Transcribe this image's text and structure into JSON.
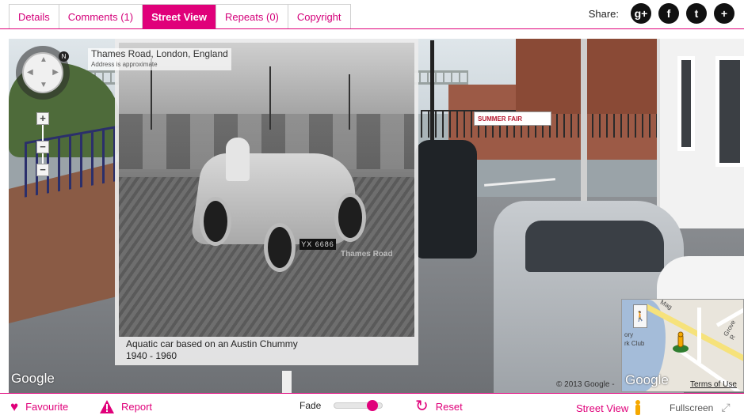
{
  "tabs": [
    {
      "label": "Details",
      "active": false
    },
    {
      "label": "Comments (1)",
      "active": false
    },
    {
      "label": "Street View",
      "active": true
    },
    {
      "label": "Repeats (0)",
      "active": false
    },
    {
      "label": "Copyright",
      "active": false
    }
  ],
  "share": {
    "label": "Share:",
    "buttons": [
      {
        "icon": "google-plus-icon",
        "glyph": "g+"
      },
      {
        "icon": "facebook-icon",
        "glyph": "f"
      },
      {
        "icon": "twitter-icon",
        "glyph": "t"
      },
      {
        "icon": "plus-icon",
        "glyph": "+"
      }
    ]
  },
  "streetview": {
    "address_line": "Thames Road, London, England",
    "address_sub": "Address is approximate",
    "google_logo": "Google",
    "compass_letter": "N",
    "zoom_in": "+",
    "zoom_out": "−",
    "zoom_out2": "−",
    "banner_text": "SUMMER FAIR"
  },
  "photo": {
    "plate": "YX 6686",
    "watermark": "Thames Road",
    "caption": "Aquatic car based on an Austin Chummy",
    "date_range": "1940 - 1960"
  },
  "minimap": {
    "google_logo": "Google",
    "copyright": "© 2013 Google -",
    "terms": "Terms of Use",
    "labels": [
      "Mag",
      "ory",
      "rk Club",
      "Grove R"
    ]
  },
  "bottom": {
    "favourite": "Favourite",
    "report": "Report",
    "fade_label": "Fade",
    "fade_value_pct": 80,
    "reset": "Reset",
    "streetview": "Street View",
    "fullscreen": "Fullscreen"
  },
  "colors": {
    "accent": "#e0007a"
  }
}
